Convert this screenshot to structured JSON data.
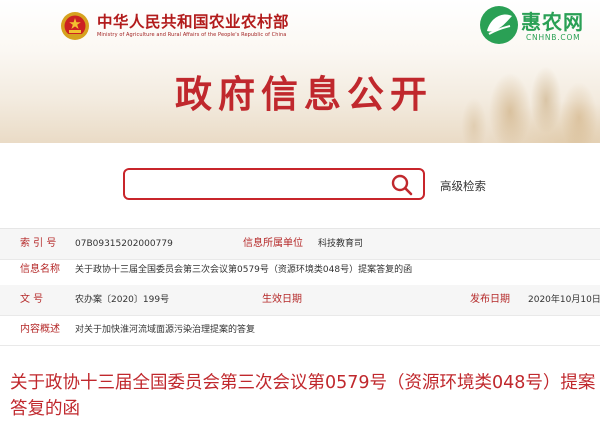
{
  "header": {
    "ministry_cn": "中华人民共和国农业农村部",
    "ministry_en": "Ministry of Agriculture and Rural Affairs of the People's Republic of China",
    "banner_title": "政府信息公开",
    "site_logo_cn": "惠农网",
    "site_logo_en": "CNHNB.COM"
  },
  "search": {
    "placeholder": "",
    "value": "",
    "advanced_label": "高级检索"
  },
  "info": {
    "index_label": "索 引 号",
    "index_value": "07B0931520200077​9",
    "owner_label": "信息所属单位",
    "owner_value": "科技教育司",
    "name_label": "信息名称",
    "name_value": "关于政协十三届全国委员会第三次会议第0579号（资源环境类048号）提案答复的函",
    "doc_no_label": "文 号",
    "doc_no_value": "农办案〔2020〕199号",
    "effective_label": "生效日期",
    "effective_value": "",
    "issue_label": "发布日期",
    "issue_value": "2020年10月10日",
    "summary_label": "内容概述",
    "summary_value": "对关于加快淮河流域面源污染治理提案的答复"
  },
  "document": {
    "title": "关于政协十三届全国委员会第三次会议第0579号（资源环境类048号）提案答复的函"
  },
  "colors": {
    "brand_red": "#c0282d",
    "label_red": "#b52a2a",
    "logo_green": "#2aa055"
  },
  "icons": {
    "national_emblem": "national-emblem-icon",
    "search": "search-icon",
    "site_logo": "leaf-logo-icon"
  }
}
